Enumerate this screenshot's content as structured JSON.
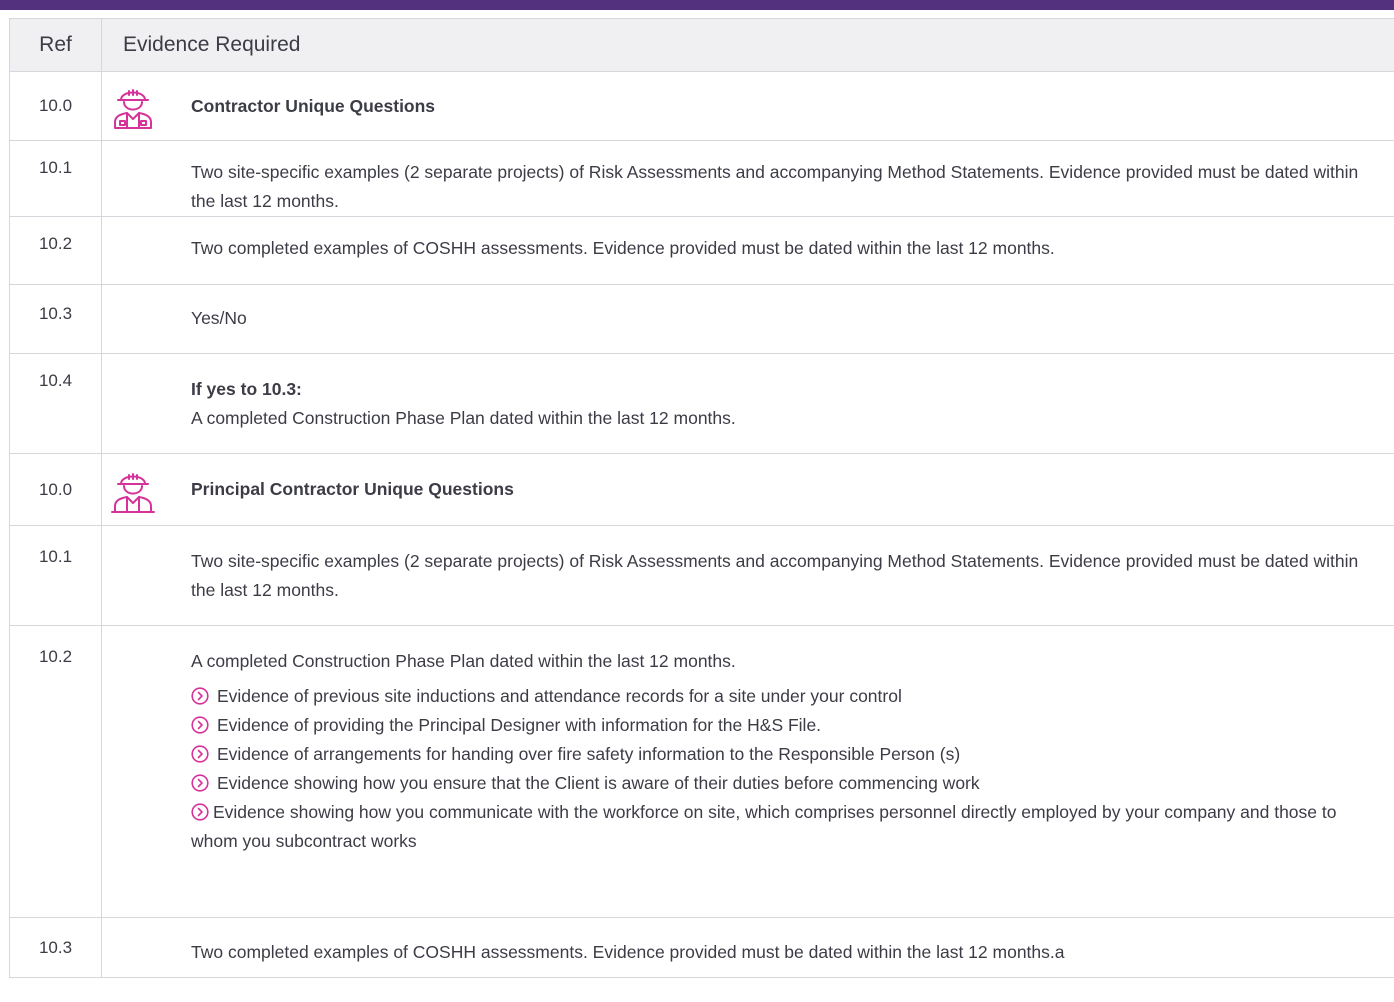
{
  "header": {
    "ref": "Ref",
    "evidence": "Evidence Required"
  },
  "rows": [
    {
      "ref": "10.0",
      "title": "Contractor Unique Questions",
      "icon": "construction-worker-icon"
    },
    {
      "ref": "10.1",
      "text": "Two site-specific examples (2 separate projects) of Risk Assessments and accompanying Method Statements. Evidence provided must be dated within the last 12 months."
    },
    {
      "ref": "10.2",
      "text": "Two completed examples of COSHH assessments. Evidence provided must be dated within the last 12 months."
    },
    {
      "ref": "10.3",
      "text": "Yes/No"
    },
    {
      "ref": "10.4",
      "bold_line": "If yes to 10.3:",
      "text": "A completed Construction Phase Plan dated within the last 12 months."
    },
    {
      "ref": "10.0",
      "title": "Principal Contractor Unique Questions",
      "icon": "construction-worker-icon"
    },
    {
      "ref": "10.1",
      "text": "Two site-specific examples (2 separate projects) of Risk Assessments and accompanying Method Statements. Evidence provided must be dated within the last 12 months."
    },
    {
      "ref": "10.2",
      "text": "A completed Construction Phase Plan dated within the last 12 months.",
      "bullets": [
        "Evidence of previous site inductions and attendance records for a site under your control",
        "Evidence of providing the Principal Designer with information for the H&S File.",
        "Evidence of arrangements for handing over fire safety information to the Responsible Person (s)",
        "Evidence showing how you ensure that the Client is aware of their duties before commencing work",
        "Evidence showing how you communicate with the workforce on site, which comprises personnel directly employed by your company and those to whom you subcontract works"
      ]
    },
    {
      "ref": "10.3",
      "text": "Two completed examples of COSHH assessments. Evidence provided must be dated within the last 12 months.a"
    }
  ],
  "colors": {
    "header_bar": "#54317e",
    "accent": "#d6339a",
    "header_row_bg": "#f0f0f3"
  }
}
